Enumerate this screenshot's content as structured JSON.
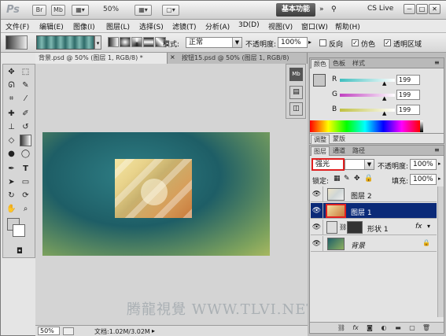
{
  "app": {
    "logo": "Ps",
    "bridge_btn": "Br",
    "mini_bridge_btn": "Mb",
    "zoom": "50%",
    "workspace": "基本功能",
    "cslive": "CS Live",
    "window_controls": [
      "－",
      "□",
      "✕"
    ]
  },
  "menu": {
    "items": [
      "文件(F)",
      "编辑(E)",
      "图像(I)",
      "图层(L)",
      "选择(S)",
      "滤镜(T)",
      "分析(A)",
      "3D(D)",
      "视图(V)",
      "窗口(W)",
      "帮助(H)"
    ]
  },
  "options": {
    "mode_label": "模式:",
    "mode_value": "正常",
    "opacity_label": "不透明度:",
    "opacity_value": "100%",
    "reverse_label": "反向",
    "dither_label": "仿色",
    "transparency_label": "透明区域",
    "reverse_checked": false,
    "dither_checked": true,
    "transparency_checked": true
  },
  "documents": {
    "tabs": [
      {
        "title": "背景.psd @ 50% (图层 1, RGB/8) *",
        "active": true
      },
      {
        "title": "按钮15.psd @ 50% (图层 1, RGB/8)",
        "active": false
      }
    ],
    "status": {
      "zoom": "50%",
      "info": "文档:1.02M/3.02M"
    }
  },
  "watermark": "腾龍視覺 WWW.TLVI.NET",
  "color_panel": {
    "tabs": [
      "颜色",
      "色板",
      "样式"
    ],
    "channels": [
      {
        "label": "R",
        "value": "199",
        "color": "#3fbfbf"
      },
      {
        "label": "G",
        "value": "199",
        "color": "#c040c0"
      },
      {
        "label": "B",
        "value": "199",
        "color": "#c0c040"
      }
    ],
    "current_color": "#c7c7c7"
  },
  "adjust_tabs": [
    "调整",
    "蒙版"
  ],
  "layers_panel": {
    "tabs": [
      "图层",
      "通道",
      "路径"
    ],
    "blend_mode": "强光",
    "opacity_label": "不透明度:",
    "opacity_value": "100%",
    "lock_label": "锁定:",
    "fill_label": "填充:",
    "fill_value": "100%",
    "layers": [
      {
        "name": "图层 2",
        "selected": false
      },
      {
        "name": "图层 1",
        "selected": true
      },
      {
        "name": "形状 1",
        "selected": false,
        "fx": "fx"
      },
      {
        "name": "背景",
        "selected": false
      }
    ]
  }
}
